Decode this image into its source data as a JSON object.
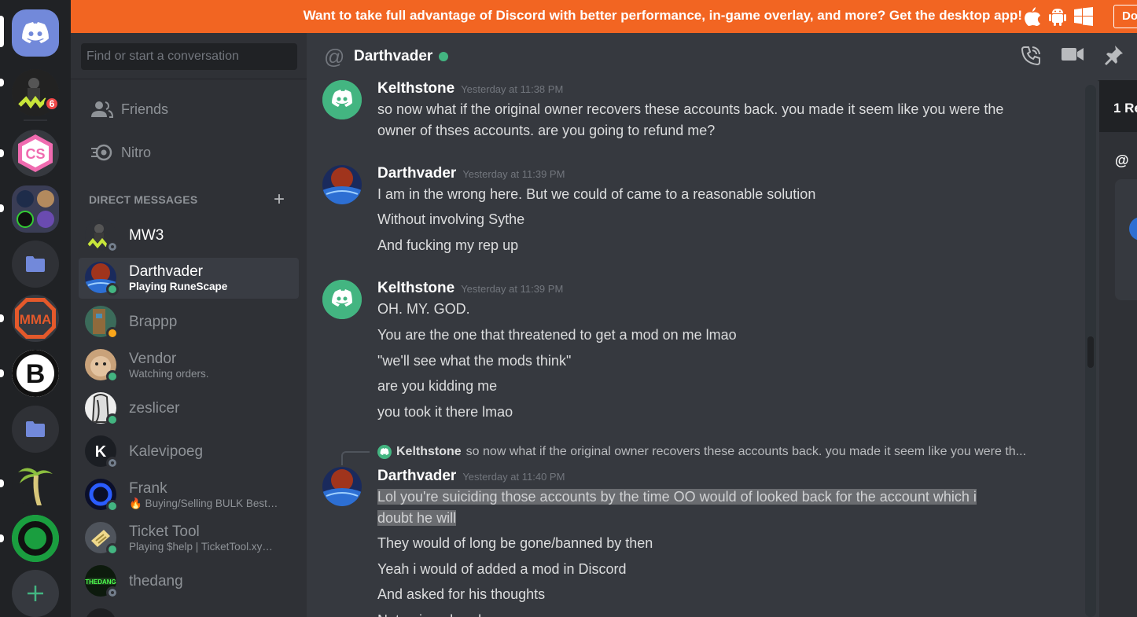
{
  "banner": {
    "text": "Want to take full advantage of Discord with better performance, in-game overlay, and more? Get the desktop app!",
    "cta": "Do"
  },
  "rail": {
    "badge_count": "6",
    "servers": [
      "home-discord",
      "mw3-server",
      "cs-server",
      "server-group",
      "folder-1",
      "mma-server",
      "b-server",
      "folder-2",
      "palm-server",
      "ring-server",
      "add-server"
    ]
  },
  "sidebar": {
    "search_placeholder": "Find or start a conversation",
    "friends_label": "Friends",
    "nitro_label": "Nitro",
    "dm_header": "DIRECT MESSAGES",
    "dm_add": "+",
    "dms": [
      {
        "name": "MW3",
        "sub": "",
        "status": "offline"
      },
      {
        "name": "Darthvader",
        "sub": "Playing RuneScape",
        "status": "online"
      },
      {
        "name": "Brappp",
        "sub": "",
        "status": "idle"
      },
      {
        "name": "Vendor",
        "sub": "Watching orders.",
        "status": "online"
      },
      {
        "name": "zeslicer",
        "sub": "",
        "status": "online"
      },
      {
        "name": "Kalevipoeg",
        "sub": "",
        "status": "offline"
      },
      {
        "name": "Frank",
        "sub": "🔥 Buying/Selling BULK Best…",
        "status": "online"
      },
      {
        "name": "Ticket Tool",
        "sub": "Playing $help | TicketTool.xy…",
        "status": "online"
      },
      {
        "name": "thedang",
        "sub": "",
        "status": "offline"
      }
    ]
  },
  "chat": {
    "at_symbol": "@",
    "channel_name": "Darthvader",
    "messages": [
      {
        "author": "Kelthstone",
        "timestamp": "Yesterday at 11:38 PM",
        "lines": [
          "so now what if the original owner recovers these accounts back. you made it seem like you were the owner of thses accounts. are you going to refund me?"
        ]
      },
      {
        "author": "Darthvader",
        "timestamp": "Yesterday at 11:39 PM",
        "lines": [
          "I am in the wrong here. But we could of came to a reasonable solution",
          "Without involving Sythe",
          "And fucking my rep up"
        ]
      },
      {
        "author": "Kelthstone",
        "timestamp": "Yesterday at 11:39 PM",
        "lines": [
          "OH. MY. GOD.",
          "You are the one that threatened to get a mod on me lmao",
          "\"we'll see what the mods think\"",
          "are you kidding me",
          "you took it there lmao"
        ]
      },
      {
        "reply_author": "Kelthstone",
        "reply_text": "so now what if the original owner recovers these accounts back. you made it seem like you were th...",
        "author": "Darthvader",
        "timestamp": "Yesterday at 11:40 PM",
        "lines": [
          "Lol you're suiciding those accounts by the time OO would of looked back for the account which i",
          "doubt he will",
          "They would of long be gone/banned by then",
          "Yeah i would of added a mod in Discord",
          "And asked for his thoughts",
          "Not going ahead"
        ]
      }
    ]
  },
  "right_panel": {
    "title": "1 Re",
    "at": "@"
  },
  "colors": {
    "banner": "#f26522",
    "online": "#43b581",
    "idle": "#faa61a",
    "blurple": "#7289da",
    "mention_badge": "#f04747"
  }
}
